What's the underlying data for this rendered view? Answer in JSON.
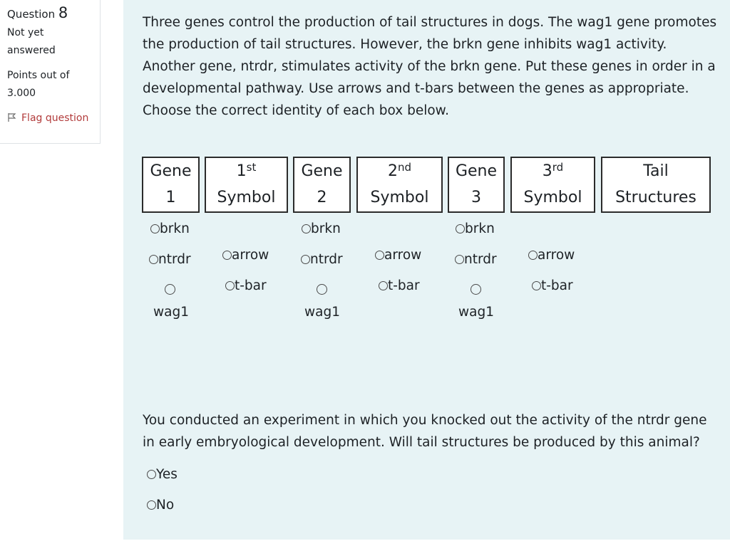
{
  "info": {
    "question_label": "Question",
    "question_number": "8",
    "state_line1": "Not yet",
    "state_line2": "answered",
    "points_line1": "Points out of",
    "points_line2": "3.000",
    "flag_label": "Flag question"
  },
  "question_text": "Three genes control the production of tail structures in dogs. The wag1 gene promotes the production of tail structures. However, the brkn gene inhibits wag1 activity. Another gene, ntrdr, stimulates activity of the brkn gene. Put these genes in order in a developmental pathway. Use arrows and t-bars between the genes as appropriate. Choose the correct identity of each box below.",
  "boxes": {
    "gene1": {
      "line1": "Gene",
      "line2": "1"
    },
    "symbol1": {
      "num": "1",
      "sup": "st",
      "line2": "Symbol"
    },
    "gene2": {
      "line1": "Gene",
      "line2": "2"
    },
    "symbol2": {
      "num": "2",
      "sup": "nd",
      "line2": "Symbol"
    },
    "gene3": {
      "line1": "Gene",
      "line2": "3"
    },
    "symbol3": {
      "num": "3",
      "sup": "rd",
      "line2": "Symbol"
    },
    "tail": {
      "line1": "Tail",
      "line2": "Structures"
    }
  },
  "gene_options": [
    "brkn",
    "ntrdr",
    "wag1"
  ],
  "symbol_options": [
    "arrow",
    "t-bar"
  ],
  "question2_text": "You conducted an experiment in which you knocked out the activity of the ntrdr gene in early embryological development. Will tail structures be produced by this animal?",
  "answer_options": [
    "Yes",
    "No"
  ]
}
